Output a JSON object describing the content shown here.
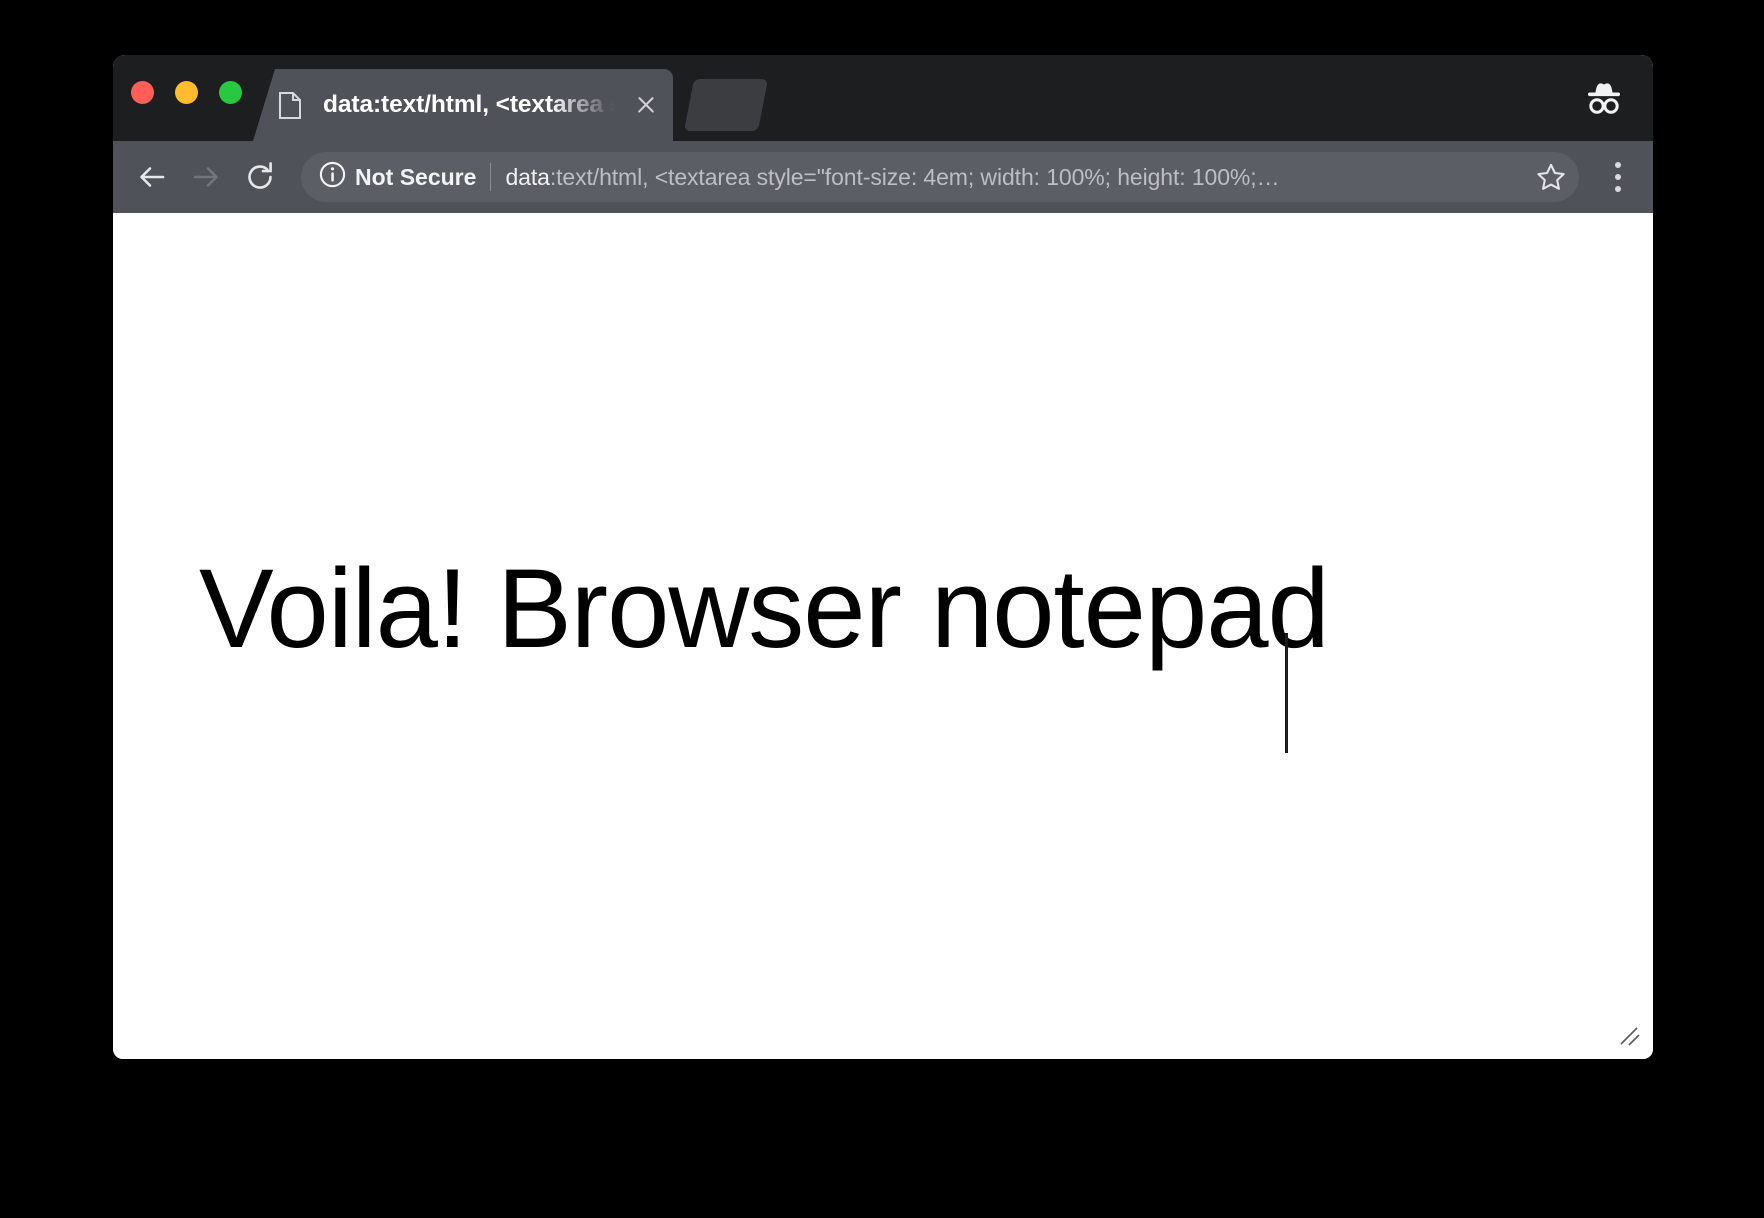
{
  "window": {
    "traffic_lights": [
      {
        "name": "close",
        "color": "#ff5f57"
      },
      {
        "name": "minimize",
        "color": "#febc2e"
      },
      {
        "name": "zoom",
        "color": "#28c840"
      }
    ]
  },
  "tab_strip": {
    "tabs": [
      {
        "title": "data:text/html, <textarea style=",
        "favicon": "document-icon",
        "close_icon": "close-icon",
        "active": true
      }
    ],
    "incognito_icon": "incognito-icon"
  },
  "toolbar": {
    "back_icon": "back-arrow-icon",
    "forward_icon": "forward-arrow-icon",
    "reload_icon": "reload-icon",
    "back_enabled": true,
    "forward_enabled": false,
    "security": {
      "icon": "info-circle-icon",
      "label": "Not Secure"
    },
    "url": {
      "scheme": "data",
      "rest": ":text/html, <textarea style=\"font-size: 4em; width: 100%; height: 100%;…"
    },
    "bookmark_icon": "star-icon",
    "menu_icon": "three-dots-vertical-icon"
  },
  "page": {
    "textarea_value": "Voila! Browser notepad",
    "textarea_placeholder": "",
    "resize_grip_icon": "resize-grip-icon",
    "text_color": "#000000",
    "background_color": "#ffffff"
  }
}
